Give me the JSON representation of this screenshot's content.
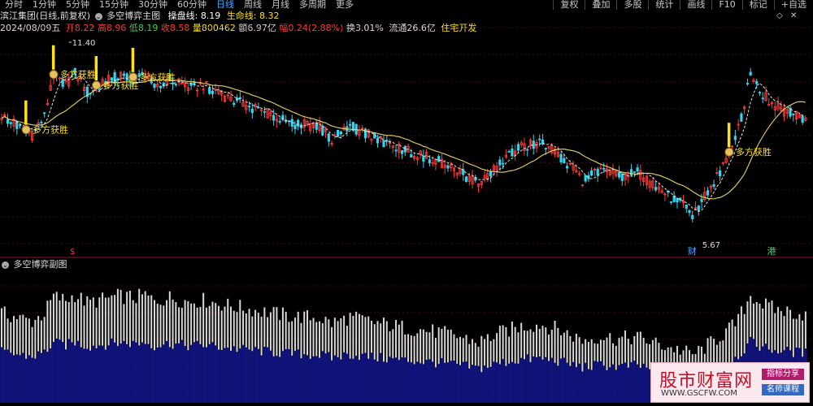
{
  "toolbar": {
    "periods": [
      "分时",
      "1分钟",
      "5分钟",
      "15分钟",
      "30分钟",
      "60分钟",
      "日线",
      "周线",
      "月线",
      "多周期",
      "更多"
    ],
    "active_period": "日线",
    "buttons": [
      "复权",
      "叠加",
      "多股",
      "统计",
      "画线",
      "F10",
      "标记",
      "+自选"
    ]
  },
  "header": {
    "stock": "滨江集团(日线,前复权)",
    "indicator_name": "多空博弈主图",
    "line1_label": "操盘线:",
    "line1_value": "8.19",
    "line2_label": "生命线:",
    "line2_value": "8.32"
  },
  "quote": {
    "date": "2024/08/09五",
    "open_label": "开",
    "open": "8.22",
    "high_label": "高",
    "high": "8.96",
    "low_label": "低",
    "low": "8.19",
    "close_label": "收",
    "close": "8.58",
    "volume_label": "量",
    "volume": "800462",
    "amount_label": "额",
    "amount": "6.97亿",
    "change_label": "幅",
    "change": "0.24(2.88%)",
    "turnover_label": "换",
    "turnover": "3.01%",
    "float_label": "流通",
    "float": "26.6亿",
    "sector": "住宅开发"
  },
  "subchart": {
    "title": "多空博弈副图"
  },
  "colors": {
    "up": "#ff3b3b",
    "down": "#35d3ef",
    "ma_short": "#e6e6e6",
    "ma_long": "#e8d46a",
    "signal": "#ffe11a",
    "bar_white": "#d8d8d8",
    "bar_blue": "#10137a",
    "accent": "#4aa8ff"
  },
  "chart_data": [
    {
      "type": "candlestick",
      "title": "多空博弈主图",
      "ylim": [
        5.2,
        11.9
      ],
      "key_points": {
        "high_label": "11.40",
        "low_label": "5.67"
      },
      "signals": [
        {
          "label": "多方获胜",
          "index": 8
        },
        {
          "label": "多方获胜",
          "index": 17
        },
        {
          "label": "多方获胜",
          "index": 31
        },
        {
          "label": "多方获胜",
          "index": 43
        },
        {
          "label": "多方获胜",
          "index": 238
        }
      ],
      "markers": [
        {
          "label": "财",
          "index": 226
        },
        {
          "label": "港",
          "index": 252
        }
      ],
      "anchors": [
        [
          0,
          9.3
        ],
        [
          5,
          9.0
        ],
        [
          10,
          8.7
        ],
        [
          14,
          9.3
        ],
        [
          17,
          10.6
        ],
        [
          21,
          10.3
        ],
        [
          24,
          10.7
        ],
        [
          28,
          10.1
        ],
        [
          32,
          10.3
        ],
        [
          38,
          10.6
        ],
        [
          44,
          10.5
        ],
        [
          47,
          10.7
        ],
        [
          50,
          10.2
        ],
        [
          55,
          10.5
        ],
        [
          61,
          10.2
        ],
        [
          66,
          10.3
        ],
        [
          74,
          9.9
        ],
        [
          84,
          9.5
        ],
        [
          94,
          9.1
        ],
        [
          104,
          8.95
        ],
        [
          108,
          8.55
        ],
        [
          114,
          9.0
        ],
        [
          122,
          8.6
        ],
        [
          132,
          8.2
        ],
        [
          142,
          7.9
        ],
        [
          150,
          7.5
        ],
        [
          156,
          7.1
        ],
        [
          160,
          7.5
        ],
        [
          164,
          7.9
        ],
        [
          170,
          8.3
        ],
        [
          176,
          8.45
        ],
        [
          182,
          8.1
        ],
        [
          190,
          7.25
        ],
        [
          196,
          7.55
        ],
        [
          202,
          7.35
        ],
        [
          208,
          7.5
        ],
        [
          214,
          7.0
        ],
        [
          218,
          6.75
        ],
        [
          222,
          6.5
        ],
        [
          226,
          6.15
        ],
        [
          229,
          6.55
        ],
        [
          233,
          7.2
        ],
        [
          236,
          7.7
        ],
        [
          240,
          8.5
        ],
        [
          243,
          9.7
        ],
        [
          245,
          10.7
        ],
        [
          249,
          10.0
        ],
        [
          253,
          9.6
        ],
        [
          258,
          9.4
        ],
        [
          263,
          9.2
        ]
      ]
    },
    {
      "type": "bar",
      "title": "多空博弈副图",
      "ylim": [
        0,
        100
      ],
      "bar_count": 264
    }
  ]
}
